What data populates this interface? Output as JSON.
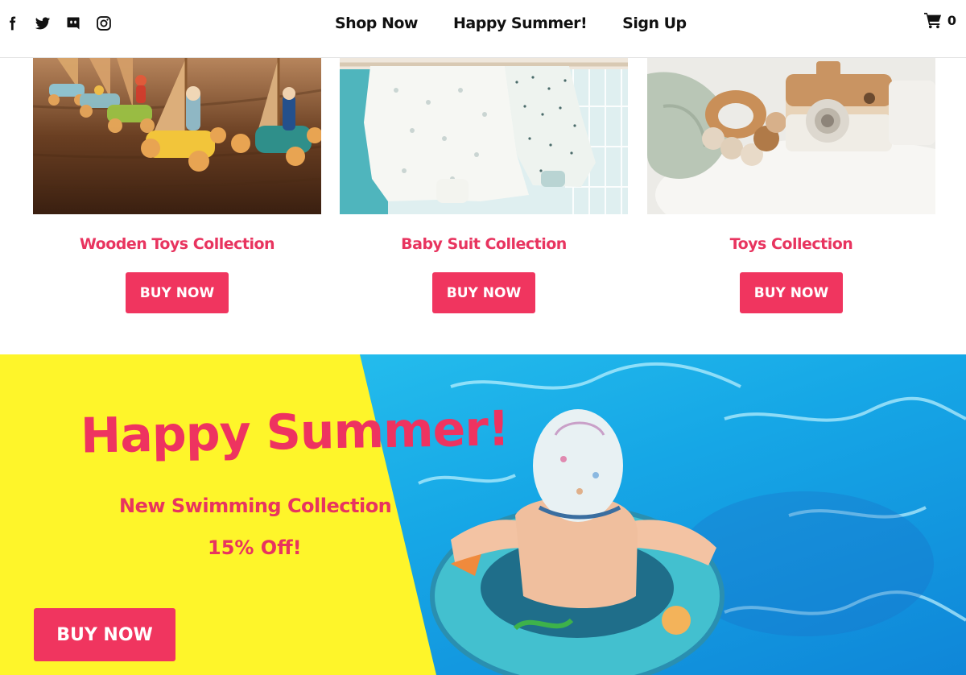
{
  "header": {
    "socials": [
      {
        "name": "facebook-icon"
      },
      {
        "name": "twitter-icon"
      },
      {
        "name": "discord-icon"
      },
      {
        "name": "instagram-icon"
      }
    ],
    "nav": [
      "Shop Now",
      "Happy Summer!",
      "Sign Up"
    ],
    "cart": {
      "icon": "cart-icon",
      "count": "0"
    }
  },
  "products": [
    {
      "title": "Wooden Toys Collection",
      "button": "BUY NOW"
    },
    {
      "title": "Baby Suit Collection",
      "button": "BUY NOW"
    },
    {
      "title": "Toys Collection",
      "button": "BUY NOW"
    }
  ],
  "hero": {
    "title": "Happy Summer!",
    "subtitle": "New Swimming Collection",
    "offer": "15% Off!",
    "button": "BUY NOW"
  },
  "colors": {
    "accent": "#f0355f",
    "accent_text": "#e8345f",
    "hero_yellow": "#fef52a",
    "pool_blue": "#1fb6ee"
  }
}
